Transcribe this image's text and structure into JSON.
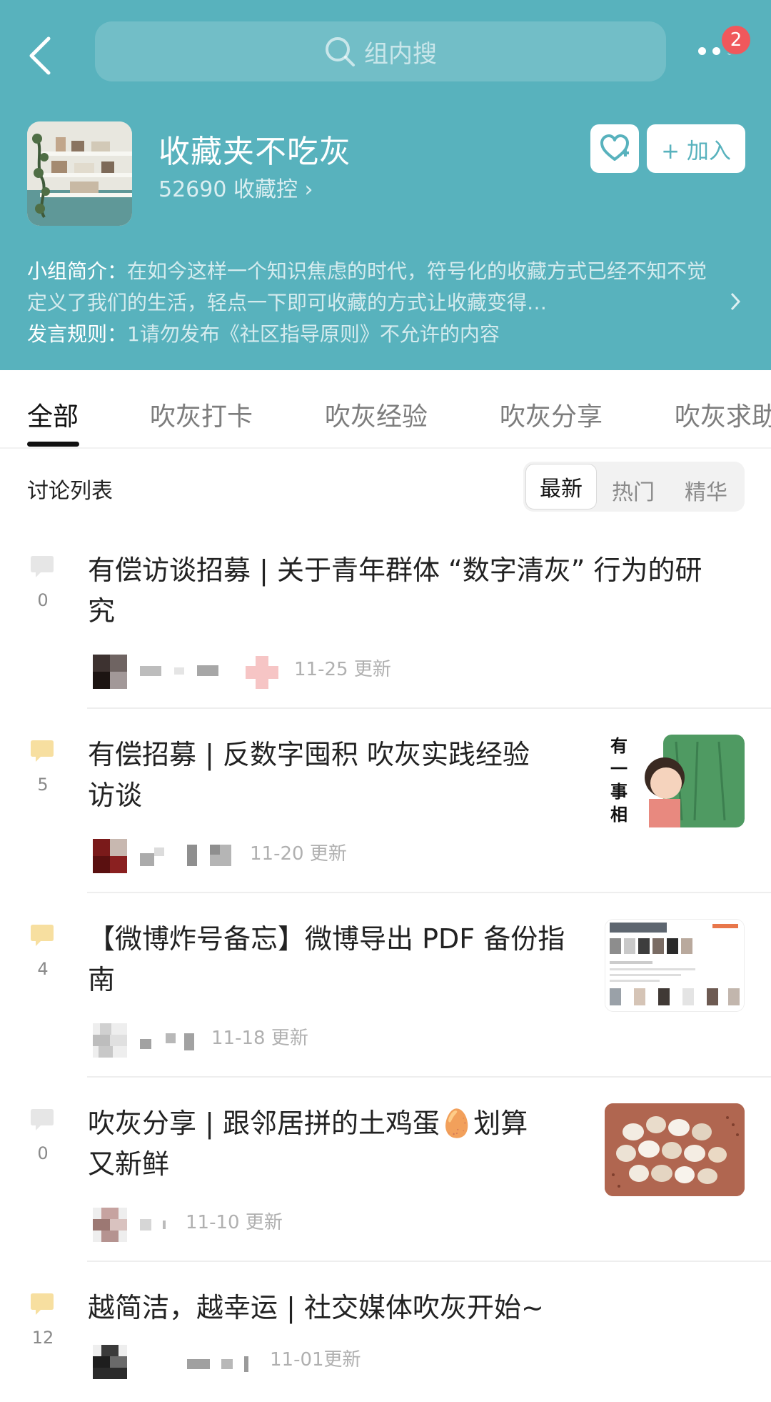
{
  "header": {
    "search_placeholder": "组内搜",
    "notification_count": "2",
    "group_name": "收藏夹不吃灰",
    "member_count_text": "52690 收藏控",
    "join_label": "+ 加入",
    "intro_label": "小组简介：",
    "intro_text": "在如今这样一个知识焦虑的时代，符号化的收藏方式已经不知不觉定义了我们的生活，轻点一下即可收藏的方式让收藏变得…",
    "rules_label": "发言规则：",
    "rules_text": "1请勿发布《社区指导原则》不允许的内容",
    "colors": {
      "header_bg": "#58b2bd",
      "badge": "#f0585c"
    }
  },
  "tabs": [
    "全部",
    "吹灰打卡",
    "吹灰经验",
    "吹灰分享",
    "吹灰求助"
  ],
  "list": {
    "title": "讨论列表",
    "sort_options": [
      "最新",
      "热门",
      "精华"
    ]
  },
  "posts": [
    {
      "comments": "0",
      "title_line1": "有偿访谈招募 | 关于青年群体 “数字清灰” 行为的研",
      "title_line2": "究",
      "updated": "11-25 更新"
    },
    {
      "comments": "5",
      "title_line1": "有偿招募 | 反数字囤积 吹灰实践经验",
      "title_line2": "访谈",
      "updated": "11-20 更新",
      "thumb_text": "有一事相求"
    },
    {
      "comments": "4",
      "title_line1": "【微博炸号备忘】微博导出 PDF 备份指",
      "title_line2": "南",
      "updated": "11-18 更新"
    },
    {
      "comments": "0",
      "title_line1": "吹灰分享 | 跟邻居拼的土鸡蛋🥚划算",
      "title_line2": "又新鲜",
      "updated": "11-10 更新"
    },
    {
      "comments": "12",
      "title_line1": "越简洁，越幸运 | 社交媒体吹灰开始~",
      "updated": "11-01更新"
    }
  ]
}
